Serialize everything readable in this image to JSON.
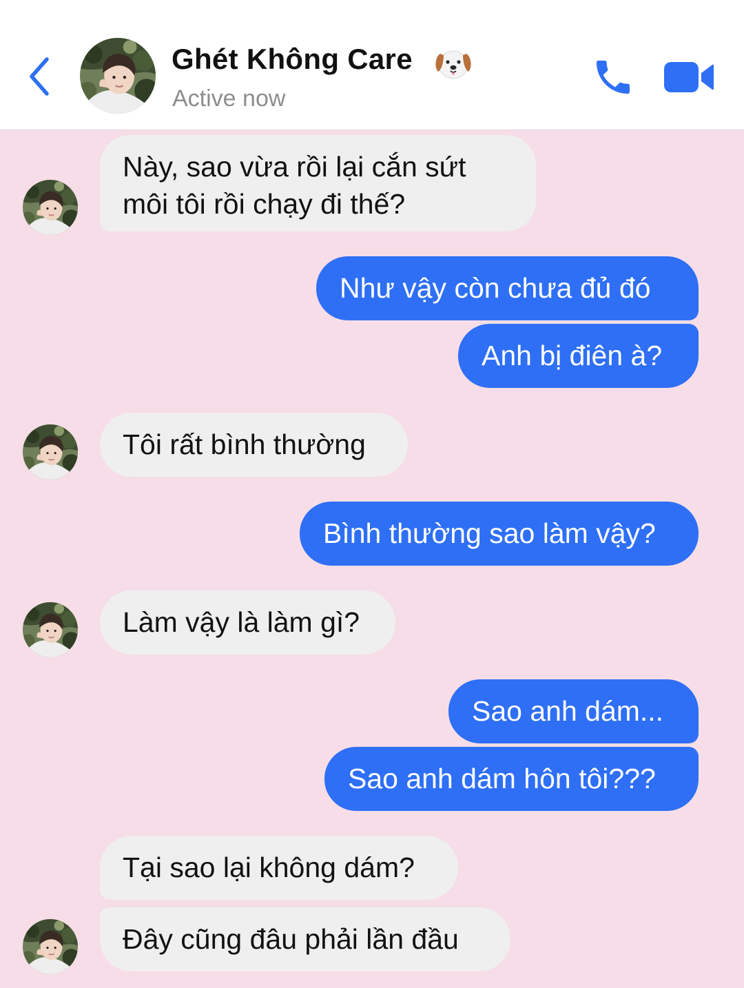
{
  "header": {
    "back_icon": "chevron-left-icon",
    "contact_name": "Ghét Không Care",
    "name_emoji": "dog-face-icon",
    "status": "Active now",
    "call_icon": "phone-icon",
    "video_icon": "video-camera-icon",
    "accent_color": "#2e6ff5"
  },
  "messages": [
    {
      "side": "incoming",
      "lines": [
        "Này, sao vừa rồi lại cắn sứt",
        "môi tôi rồi chạy đi thế?"
      ]
    },
    {
      "side": "outgoing",
      "text": "Như vậy còn chưa đủ đó"
    },
    {
      "side": "outgoing",
      "text": "Anh bị điên à?"
    },
    {
      "side": "incoming",
      "text": "Tôi rất bình thường"
    },
    {
      "side": "outgoing",
      "text": "Bình thường sao làm vậy?"
    },
    {
      "side": "incoming",
      "text": "Làm vậy là làm gì?"
    },
    {
      "side": "outgoing",
      "text": "Sao anh dám..."
    },
    {
      "side": "outgoing",
      "text": "Sao anh dám hôn tôi???"
    },
    {
      "side": "incoming",
      "text": "Tại sao lại không dám?"
    },
    {
      "side": "incoming",
      "text": "Đây cũng đâu phải lần đầu"
    }
  ],
  "theme": {
    "chat_background": "#f6dde7",
    "incoming_bubble": "#efefef",
    "outgoing_bubble": "#2e6ff5"
  }
}
